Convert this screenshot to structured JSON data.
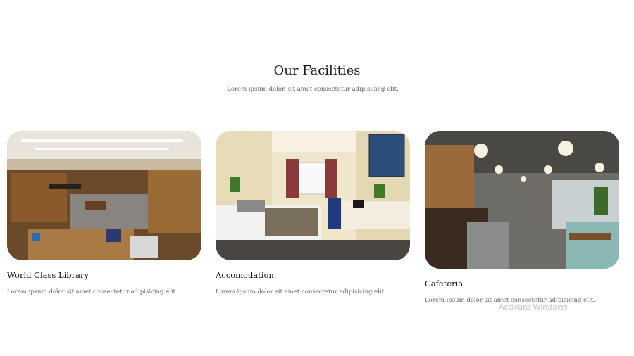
{
  "section": {
    "title": "Our Facilities",
    "subtitle": "Lorem ipsum dolor, sit amet consectetur adipisicing elit."
  },
  "facilities": [
    {
      "title": "World Class Library",
      "text": "Lorem ipsum dolor sit amet consectetur adipisicing elit."
    },
    {
      "title": "Accomodation",
      "text": "Lorem ipsum dolor sit amet consectetur adipisicing elit."
    },
    {
      "title": "Cafeteria",
      "text": "Lorem ipsum dolor sit amet consectetur adipisicing elit."
    }
  ],
  "watermark": "Activate Windows"
}
